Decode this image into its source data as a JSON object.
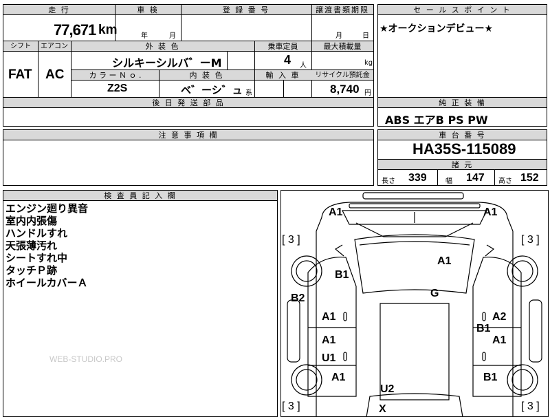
{
  "main_table": {
    "header": {
      "mileage": "走 行",
      "inspection": "車 検",
      "registration": "登 録 番 号",
      "transfer_deadline": "譲渡書類期限"
    },
    "mileage_value": "77,671",
    "mileage_unit": "km",
    "inspection_year_unit": "年",
    "inspection_month_unit": "月",
    "transfer_month_unit": "月",
    "transfer_day_unit": "日",
    "row2_header": {
      "shift": "シフト",
      "aircon": "エアコン",
      "exterior_color": "外 装 色",
      "capacity": "乗車定員",
      "max_load": "最大積載量"
    },
    "shift_value": "FAT",
    "aircon_value": "AC",
    "exterior_color_value": "シルキーシルバ゛ーM",
    "capacity_value": "4",
    "capacity_unit": "人",
    "max_load_unit": "kg",
    "row3_header": {
      "color_no": "カ ラ ー Ｎ ｏ .",
      "interior_color": "内 装 色",
      "import": "輸 入 車",
      "recycle": "リサイクル預託金"
    },
    "color_no_value": "Z2S",
    "interior_color_value": "ベ゛ーシ゛ュ",
    "interior_suffix": "系",
    "recycle_value": "8,740",
    "recycle_unit": "円",
    "parts_header": "後 日 発 送 部 品"
  },
  "sales_point": {
    "header": "セ ー ル ス ポ イ ン ト",
    "text": "★オークションデビュー★"
  },
  "equipment": {
    "header": "純 正 装 備",
    "text": "ABS エアB PS PW"
  },
  "caution": {
    "header": "注 意 事 項 欄"
  },
  "chassis": {
    "header": "車 台 番 号",
    "value": "HA35S-115089",
    "spec_header": "諸 元",
    "length_label": "長さ",
    "length_value": "339",
    "width_label": "幅",
    "width_value": "147",
    "height_label": "高さ",
    "height_value": "152"
  },
  "inspector": {
    "header": "検 査 員 記 入 欄",
    "notes": [
      "エンジン廻り異音",
      "室内内張傷",
      "ハンドルすれ",
      "天張薄汚れ",
      "シートすれ中",
      "タッチＰ跡",
      "ホイールカバーＡ"
    ]
  },
  "watermark": "WEB-STUDIO.PRO",
  "diagram": {
    "marks": {
      "front_left": "A1",
      "front_right": "A1",
      "bracket_left_top": "[ 3 ]",
      "bracket_right_top": "[ 3 ]",
      "windshield": "A1",
      "hood_left": "B1",
      "left_fender": "B2",
      "roof": "G",
      "left_front_door": "A1",
      "right_front_door_a": "A2",
      "right_front_door_b": "B1",
      "left_rear_door": "A1",
      "right_rear_door": "A1",
      "left_step": "U1",
      "left_rear_quarter": "A1",
      "right_rear_quarter": "B1",
      "rear": "U2",
      "rear_x": "X",
      "bracket_left_bottom": "[ 3 ]",
      "bracket_right_bottom": "[ 3 ]"
    }
  }
}
